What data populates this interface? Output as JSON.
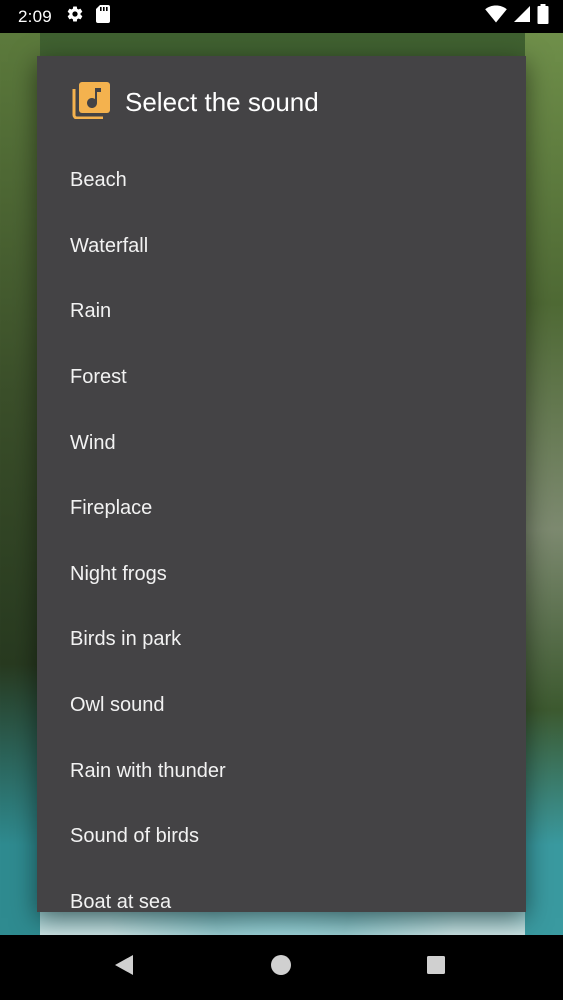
{
  "status_bar": {
    "time": "2:09",
    "icons_left": [
      "gear-icon",
      "sd-card-icon"
    ],
    "icons_right": [
      "wifi-icon",
      "signal-icon",
      "battery-icon"
    ]
  },
  "dialog": {
    "title": "Select the sound",
    "title_icon": "music-library-icon",
    "accent_color": "#F4B24E",
    "background_color": "#444345",
    "items": [
      {
        "label": "Beach"
      },
      {
        "label": "Waterfall"
      },
      {
        "label": "Rain"
      },
      {
        "label": "Forest"
      },
      {
        "label": "Wind"
      },
      {
        "label": "Fireplace"
      },
      {
        "label": "Night frogs"
      },
      {
        "label": "Birds in park"
      },
      {
        "label": "Owl sound"
      },
      {
        "label": "Rain with thunder"
      },
      {
        "label": "Sound of birds"
      },
      {
        "label": "Boat at sea"
      }
    ]
  },
  "nav_bar": {
    "buttons": [
      "back-icon",
      "home-icon",
      "recents-icon"
    ]
  }
}
